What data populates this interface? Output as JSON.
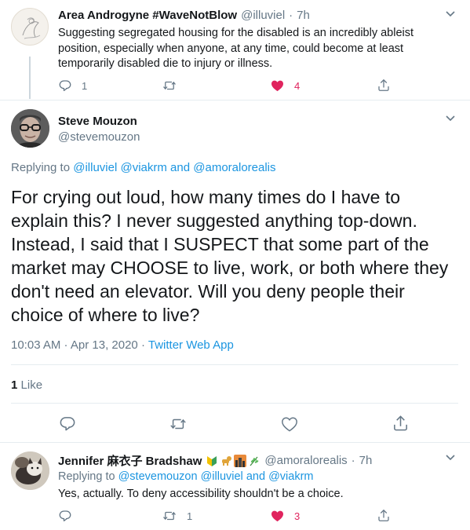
{
  "tweet1": {
    "name": "Area Androgyne #WaveNotBlow",
    "handle": "@illuviel",
    "sep": "·",
    "time": "7h",
    "text": "Suggesting segregated housing for the disabled is an incredibly ableist position, especially when anyone, at any time, could become at least temporarily disabled die to injury or illness.",
    "reply_count": "1",
    "like_count": "4"
  },
  "main": {
    "name": "Steve Mouzon",
    "handle": "@stevemouzon",
    "replying_prefix": "Replying to",
    "mention1": "@illuviel",
    "mention2": "@viakrm",
    "and_word": "and",
    "mention3": "@amoralorealis",
    "body": [
      "For crying out loud, how many times do I have to",
      "explain this? I never suggested anything top-down.",
      "Instead, I said that I SUSPECT that some part of the",
      "market may CHOOSE to live, work, or both where they",
      "don't need an elevator. Will you deny people their",
      "choice of where to live?"
    ],
    "timestamp": "10:03 AM · Apr 13, 2020 ·",
    "source": "Twitter Web App",
    "likes_number": "1",
    "likes_label": "Like"
  },
  "tweet3": {
    "name": "Jennifer 麻衣子 Bradshaw",
    "handle": "@amoralorealis",
    "sep": "·",
    "time": "7h",
    "replying_prefix": "Replying to",
    "mention1": "@stevemouzon",
    "mention2": "@illuviel",
    "and_word": "and",
    "mention3": "@viakrm",
    "text": "Yes, actually. To deny accessibility shouldn't be a choice.",
    "retweet_count": "1",
    "like_count": "3"
  },
  "colors": {
    "like_red": "#e0245e",
    "link_blue": "#1b95e0",
    "secondary_gray": "#657786"
  }
}
